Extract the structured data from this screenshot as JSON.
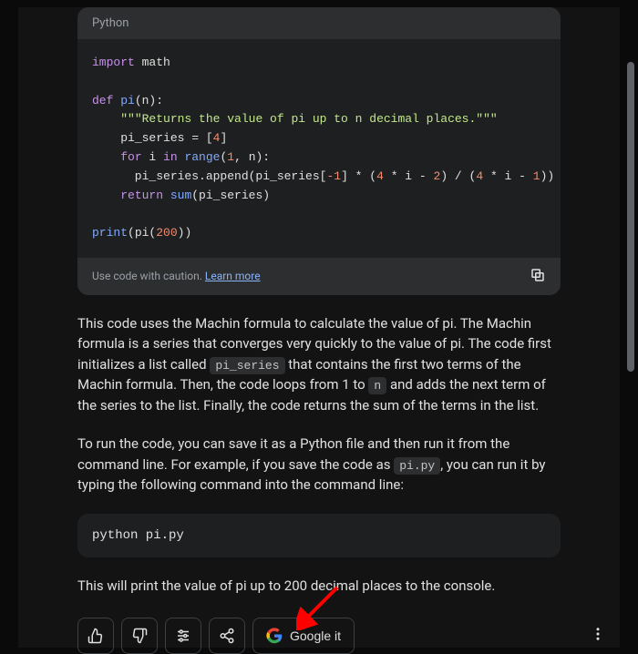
{
  "code_block": {
    "language": "Python",
    "tokens": [
      {
        "t": "import",
        "c": "kw"
      },
      {
        "t": " math\n\n",
        "c": "id"
      },
      {
        "t": "def",
        "c": "kw"
      },
      {
        "t": " ",
        "c": "id"
      },
      {
        "t": "pi",
        "c": "fn"
      },
      {
        "t": "(n):\n",
        "c": "id"
      },
      {
        "t": "    ",
        "c": "id"
      },
      {
        "t": "\"\"\"Returns the value of pi up to n decimal places.\"\"\"",
        "c": "str"
      },
      {
        "t": "\n",
        "c": "id"
      },
      {
        "t": "    pi_series = [",
        "c": "id"
      },
      {
        "t": "4",
        "c": "num"
      },
      {
        "t": "]\n",
        "c": "id"
      },
      {
        "t": "    ",
        "c": "id"
      },
      {
        "t": "for",
        "c": "kw"
      },
      {
        "t": " i ",
        "c": "id"
      },
      {
        "t": "in",
        "c": "kw"
      },
      {
        "t": " ",
        "c": "id"
      },
      {
        "t": "range",
        "c": "fn"
      },
      {
        "t": "(",
        "c": "id"
      },
      {
        "t": "1",
        "c": "num"
      },
      {
        "t": ", n):\n",
        "c": "id"
      },
      {
        "t": "      pi_series.append(pi_series[",
        "c": "id"
      },
      {
        "t": "-1",
        "c": "num"
      },
      {
        "t": "] * (",
        "c": "id"
      },
      {
        "t": "4",
        "c": "num"
      },
      {
        "t": " * i - ",
        "c": "id"
      },
      {
        "t": "2",
        "c": "num"
      },
      {
        "t": ") / (",
        "c": "id"
      },
      {
        "t": "4",
        "c": "num"
      },
      {
        "t": " * i - ",
        "c": "id"
      },
      {
        "t": "1",
        "c": "num"
      },
      {
        "t": "))\n",
        "c": "id"
      },
      {
        "t": "    ",
        "c": "id"
      },
      {
        "t": "return",
        "c": "kw"
      },
      {
        "t": " ",
        "c": "id"
      },
      {
        "t": "sum",
        "c": "fn"
      },
      {
        "t": "(pi_series)\n\n",
        "c": "id"
      },
      {
        "t": "print",
        "c": "fn"
      },
      {
        "t": "(pi(",
        "c": "id"
      },
      {
        "t": "200",
        "c": "num"
      },
      {
        "t": "))",
        "c": "id"
      }
    ],
    "footer_text": "Use code with caution. ",
    "footer_link": "Learn more"
  },
  "paragraphs": {
    "p1_parts": [
      {
        "text": "This code uses the Machin formula to calculate the value of pi. The Machin formula is a series that converges very quickly to the value of pi. The code first initializes a list called "
      },
      {
        "code": "pi_series"
      },
      {
        "text": " that contains the first two terms of the Machin formula. Then, the code loops from 1 to "
      },
      {
        "code": "n"
      },
      {
        "text": " and adds the next term of the series to the list. Finally, the code returns the sum of the terms in the list."
      }
    ],
    "p2_parts": [
      {
        "text": "To run the code, you can save it as a Python file and then run it from the command line. For example, if you save the code as "
      },
      {
        "code": "pi.py"
      },
      {
        "text": ", you can run it by typing the following command into the command line:"
      }
    ],
    "p3": "This will print the value of pi up to 200 decimal places to the console."
  },
  "command_block": "python pi.py",
  "actions": {
    "google_it": "Google it"
  }
}
